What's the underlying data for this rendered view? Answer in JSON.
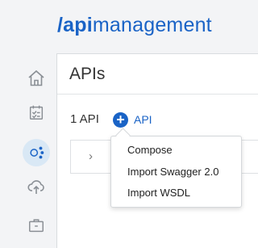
{
  "header": {
    "brand_slash": "/",
    "brand_strong": "api",
    "brand_light": "management"
  },
  "sidebar": {
    "items": [
      {
        "icon": "home-icon",
        "active": false
      },
      {
        "icon": "calendar-check-icon",
        "active": false
      },
      {
        "icon": "api-node-icon",
        "active": true
      },
      {
        "icon": "cloud-upload-icon",
        "active": false
      },
      {
        "icon": "briefcase-icon",
        "active": false
      }
    ]
  },
  "main": {
    "title": "APIs",
    "count_label": "1 API",
    "add_label": "API",
    "add_icon": "plus-circle-icon",
    "row_expander_icon": "chevron-right-icon"
  },
  "menu": {
    "items": [
      {
        "label": "Compose"
      },
      {
        "label": "Import Swagger 2.0"
      },
      {
        "label": "Import WSDL"
      }
    ]
  },
  "colors": {
    "accent": "#1a63c6",
    "icon_gray": "#8a8f95",
    "active_bg": "#d9e8f5"
  }
}
